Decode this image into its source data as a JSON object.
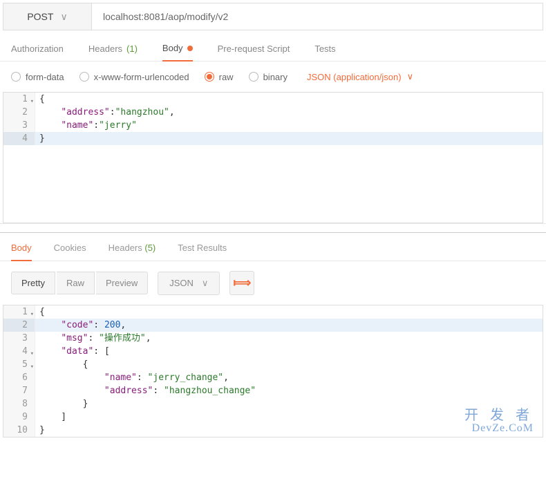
{
  "request": {
    "method": "POST",
    "url": "localhost:8081/aop/modify/v2"
  },
  "reqTabs": {
    "authorization": "Authorization",
    "headers": "Headers",
    "headersCount": "(1)",
    "body": "Body",
    "prerequest": "Pre-request Script",
    "tests": "Tests"
  },
  "bodyTypes": {
    "formData": "form-data",
    "urlencoded": "x-www-form-urlencoded",
    "raw": "raw",
    "binary": "binary",
    "contentType": "JSON (application/json)"
  },
  "reqBody": {
    "l1": {
      "n": "1",
      "t": "{"
    },
    "l2": {
      "n": "2",
      "k": "\"address\"",
      "v": "\"hangzhou\"",
      "trail": ","
    },
    "l3": {
      "n": "3",
      "k": "\"name\"",
      "v": "\"jerry\""
    },
    "l4": {
      "n": "4",
      "t": "}"
    }
  },
  "respTabs": {
    "body": "Body",
    "cookies": "Cookies",
    "headers": "Headers",
    "headersCount": "(5)",
    "testResults": "Test Results"
  },
  "respToolbar": {
    "pretty": "Pretty",
    "raw": "Raw",
    "preview": "Preview",
    "format": "JSON"
  },
  "respBody": {
    "l1": {
      "n": "1",
      "t": "{"
    },
    "l2": {
      "n": "2",
      "k": "\"code\"",
      "v": "200",
      "trail": ","
    },
    "l3": {
      "n": "3",
      "k": "\"msg\"",
      "v": "\"操作成功\"",
      "trail": ","
    },
    "l4": {
      "n": "4",
      "k": "\"data\"",
      "v": "[",
      "bracket": true
    },
    "l5": {
      "n": "5",
      "t": "        {"
    },
    "l6": {
      "n": "6",
      "k": "\"name\"",
      "v": "\"jerry_change\"",
      "trail": ",",
      "indent": "            "
    },
    "l7": {
      "n": "7",
      "k": "\"address\"",
      "v": "\"hangzhou_change\"",
      "indent": "            "
    },
    "l8": {
      "n": "8",
      "t": "        }"
    },
    "l9": {
      "n": "9",
      "t": "    ]"
    },
    "l10": {
      "n": "10",
      "t": "}"
    }
  },
  "watermark": {
    "line1": "开 发 者",
    "line2": "DevZe.CoM"
  }
}
